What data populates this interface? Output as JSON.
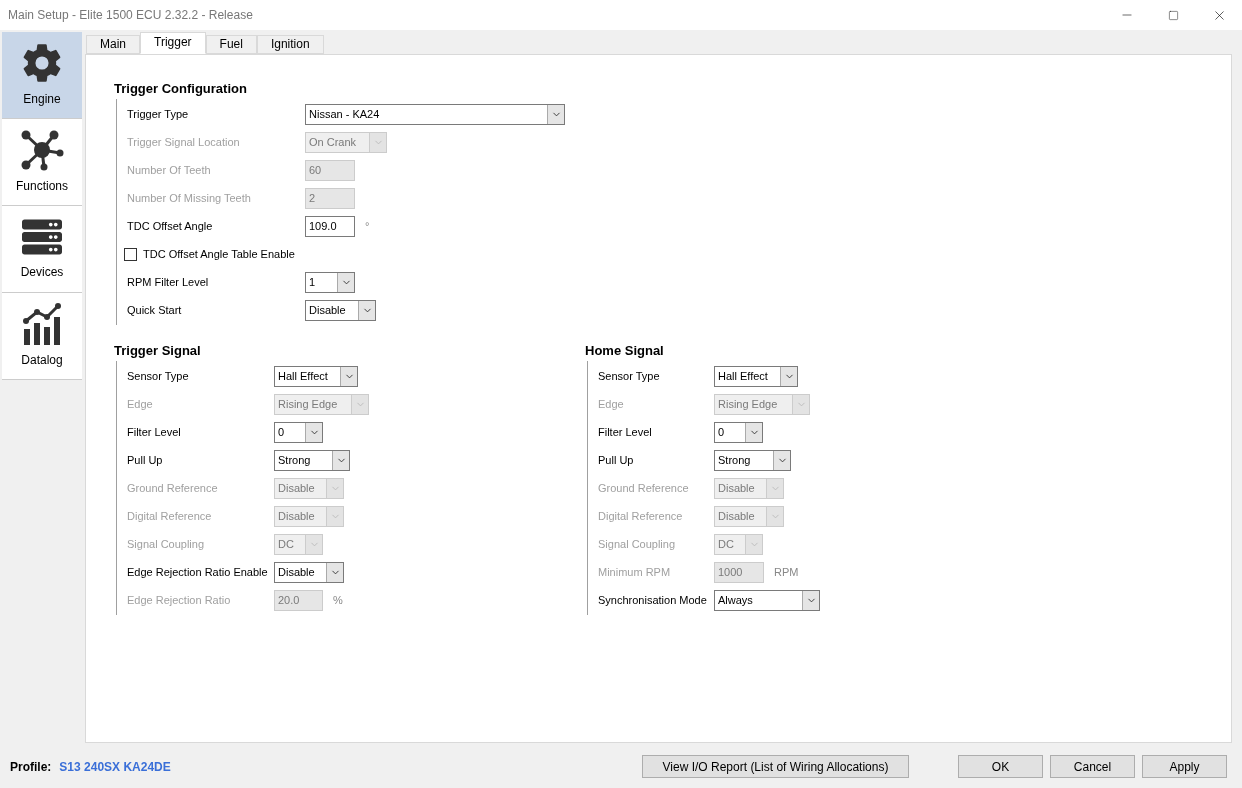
{
  "window": {
    "title": "Main Setup - Elite 1500 ECU 2.32.2 - Release"
  },
  "sidebar": {
    "items": [
      {
        "label": "Engine",
        "selected": true
      },
      {
        "label": "Functions",
        "selected": false
      },
      {
        "label": "Devices",
        "selected": false
      },
      {
        "label": "Datalog",
        "selected": false
      }
    ]
  },
  "tabs": [
    {
      "label": "Main",
      "selected": false
    },
    {
      "label": "Trigger",
      "selected": true
    },
    {
      "label": "Fuel",
      "selected": false
    },
    {
      "label": "Ignition",
      "selected": false
    }
  ],
  "sections": [
    {
      "title": "Trigger Configuration",
      "rows": [
        {
          "kind": "select",
          "label": "Trigger Type",
          "value": "Nissan - KA24",
          "disabled": false
        },
        {
          "kind": "select",
          "label": "Trigger Signal Location",
          "value": "On Crank",
          "disabled": true
        },
        {
          "kind": "text",
          "label": "Number Of Teeth",
          "value": "60",
          "disabled": true
        },
        {
          "kind": "text",
          "label": "Number Of Missing Teeth",
          "value": "2",
          "disabled": true
        },
        {
          "kind": "text",
          "label": "TDC Offset Angle",
          "value": "109.0",
          "unit": "°",
          "disabled": false
        },
        {
          "kind": "checkbox",
          "label": "TDC Offset Angle Table Enable",
          "checked": false
        },
        {
          "kind": "select",
          "label": "RPM Filter Level",
          "value": "1",
          "disabled": false
        },
        {
          "kind": "select",
          "label": "Quick Start",
          "value": "Disable",
          "disabled": false
        }
      ]
    },
    {
      "title": "Trigger Signal",
      "rows": [
        {
          "kind": "select",
          "label": "Sensor Type",
          "value": "Hall Effect",
          "disabled": false
        },
        {
          "kind": "select",
          "label": "Edge",
          "value": "Rising Edge",
          "disabled": true
        },
        {
          "kind": "select",
          "label": "Filter Level",
          "value": "0",
          "disabled": false
        },
        {
          "kind": "select",
          "label": "Pull Up",
          "value": "Strong",
          "disabled": false
        },
        {
          "kind": "select",
          "label": "Ground Reference",
          "value": "Disable",
          "disabled": true
        },
        {
          "kind": "select",
          "label": "Digital Reference",
          "value": "Disable",
          "disabled": true
        },
        {
          "kind": "select",
          "label": "Signal Coupling",
          "value": "DC",
          "disabled": true
        },
        {
          "kind": "select",
          "label": "Edge Rejection Ratio Enable",
          "value": "Disable",
          "disabled": false
        },
        {
          "kind": "text",
          "label": "Edge Rejection Ratio",
          "value": "20.0",
          "unit": "%",
          "disabled": true
        }
      ]
    },
    {
      "title": "Home Signal",
      "rows": [
        {
          "kind": "select",
          "label": "Sensor Type",
          "value": "Hall Effect",
          "disabled": false
        },
        {
          "kind": "select",
          "label": "Edge",
          "value": "Rising Edge",
          "disabled": true
        },
        {
          "kind": "select",
          "label": "Filter Level",
          "value": "0",
          "disabled": false
        },
        {
          "kind": "select",
          "label": "Pull Up",
          "value": "Strong",
          "disabled": false
        },
        {
          "kind": "select",
          "label": "Ground Reference",
          "value": "Disable",
          "disabled": true
        },
        {
          "kind": "select",
          "label": "Digital Reference",
          "value": "Disable",
          "disabled": true
        },
        {
          "kind": "select",
          "label": "Signal Coupling",
          "value": "DC",
          "disabled": true
        },
        {
          "kind": "text",
          "label": "Minimum RPM",
          "value": "1000",
          "unit": "RPM",
          "disabled": true
        },
        {
          "kind": "select",
          "label": "Synchronisation Mode",
          "value": "Always",
          "disabled": false
        }
      ]
    }
  ],
  "footer": {
    "profile_label": "Profile:",
    "profile_value": "S13 240SX KA24DE",
    "report_button": "View I/O Report (List of Wiring Allocations)",
    "buttons": [
      "OK",
      "Cancel",
      "Apply"
    ]
  }
}
